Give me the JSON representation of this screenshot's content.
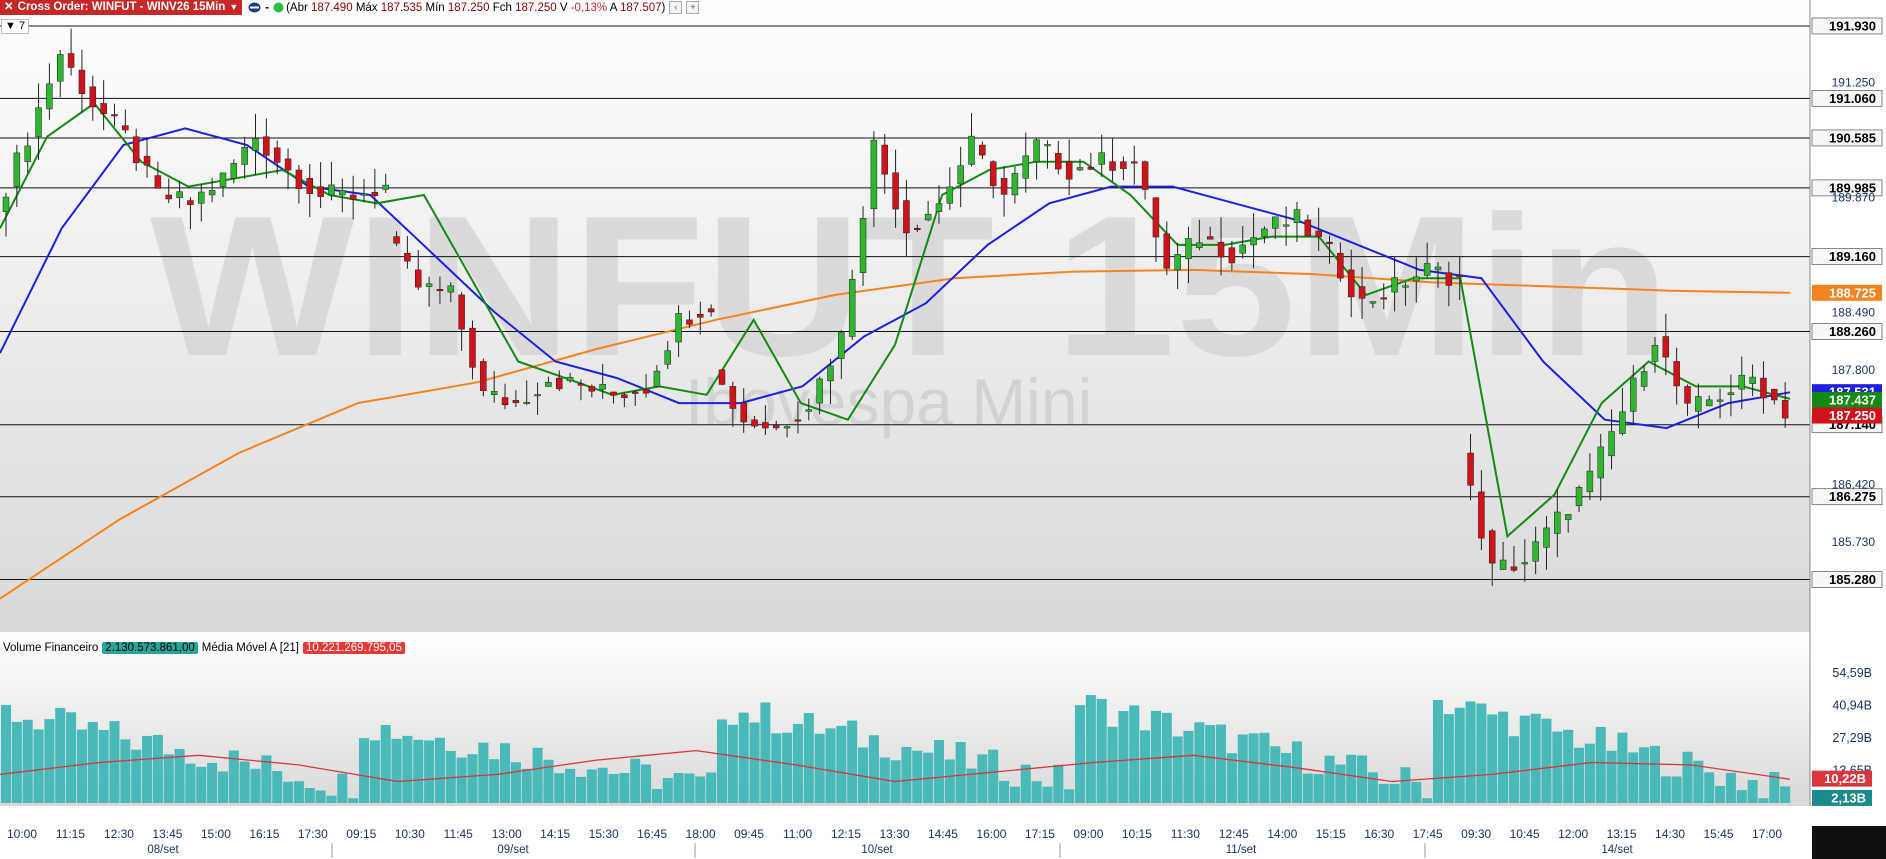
{
  "header": {
    "cross_order_label": "Cross Order: WINFUT - WINV26 15Min",
    "dash": "-",
    "ohlc": {
      "abr_label": "Abr",
      "abr": "187.490",
      "max_label": "Máx",
      "max": "187.535",
      "min_label": "Mín",
      "min": "187.250",
      "fch_label": "Fch",
      "fch": "187.250",
      "v_label": "V",
      "v": "-0,13%",
      "a_label": "A",
      "a": "187.507"
    }
  },
  "candle_count": "7",
  "watermark": {
    "symbol": "WINFUT 15Min",
    "name": "Ibovespa Mini"
  },
  "volume_panel": {
    "label": "Volume Financeiro",
    "value": "2.130.573.861,00",
    "ma_label": "Média Móvel A [21]",
    "ma_value": "10.221.269.795,05"
  },
  "colors": {
    "up": "#2fb52f",
    "down": "#d0131a",
    "ema_fast": "#138a13",
    "ema_mid": "#1f1fe0",
    "ema_slow": "#f5841f",
    "volume": "#4ab9b9",
    "volume_ma": "#d9363e",
    "level_line": "#111111"
  },
  "chart_data": [
    {
      "type": "candlestick",
      "y_axis": {
        "range": [
          184.65,
          192.05
        ],
        "tick_labels": [
          "191.250",
          "189.870",
          "188.490",
          "187.800",
          "186.420",
          "185.730"
        ]
      },
      "x_axis": {
        "time_labels": [
          "10:00",
          "11:15",
          "12:30",
          "13:45",
          "15:00",
          "16:15",
          "17:30",
          "09:15",
          "10:30",
          "11:45",
          "13:00",
          "14:15",
          "15:30",
          "16:45",
          "18:00",
          "09:45",
          "11:00",
          "12:15",
          "13:30",
          "14:45",
          "16:00",
          "17:15",
          "09:00",
          "10:15",
          "11:30",
          "12:45",
          "14:00",
          "15:15",
          "16:30",
          "17:45",
          "09:30",
          "10:45",
          "12:00",
          "13:15",
          "14:30",
          "15:45",
          "17:00"
        ],
        "date_labels": [
          "08/set",
          "09/set",
          "10/set",
          "11/set",
          "14/set"
        ]
      },
      "levels": [
        191.93,
        191.06,
        190.585,
        189.985,
        189.16,
        188.26,
        187.14,
        186.275,
        185.28
      ],
      "level_labels": [
        "191.930",
        "191.060",
        "190.585",
        "189.985",
        "189.160",
        "188.260",
        "187.140",
        "186.275",
        "185.280"
      ],
      "price_tags": [
        {
          "value": 188.725,
          "label": "188.725",
          "color": "#f5841f"
        },
        {
          "value": 187.531,
          "label": "187.531",
          "color": "#1f1fe0"
        },
        {
          "value": 187.437,
          "label": "187.437",
          "color": "#138a13"
        },
        {
          "value": 187.25,
          "label": "187.250",
          "color": "#d0131a"
        }
      ],
      "session_anchors": [
        {
          "o": 189.7,
          "c": 190.6
        },
        {
          "o": 190.6,
          "c": 191.6
        },
        {
          "o": 191.6,
          "c": 191.0
        },
        {
          "o": 191.0,
          "c": 190.6
        },
        {
          "o": 190.6,
          "c": 189.9
        },
        {
          "o": 189.9,
          "c": 189.8
        },
        {
          "o": 189.8,
          "c": 190.1
        },
        {
          "o": 190.1,
          "c": 190.6
        },
        {
          "o": 190.6,
          "c": 190.2
        },
        {
          "o": 190.2,
          "c": 189.9
        },
        {
          "o": 189.9,
          "c": 189.9
        },
        {
          "o": 189.9,
          "c": 190.0
        },
        {
          "o": 189.4,
          "c": 188.8
        },
        {
          "o": 188.8,
          "c": 188.7
        },
        {
          "o": 188.7,
          "c": 187.5
        },
        {
          "o": 187.5,
          "c": 187.4
        },
        {
          "o": 187.4,
          "c": 187.7
        },
        {
          "o": 187.7,
          "c": 187.6
        },
        {
          "o": 187.6,
          "c": 187.5
        },
        {
          "o": 187.5,
          "c": 187.6
        },
        {
          "o": 187.6,
          "c": 188.4
        },
        {
          "o": 188.4,
          "c": 188.6
        },
        {
          "o": 187.8,
          "c": 187.2
        },
        {
          "o": 187.2,
          "c": 187.1
        },
        {
          "o": 187.1,
          "c": 187.4
        },
        {
          "o": 187.4,
          "c": 188.2
        },
        {
          "o": 188.2,
          "c": 190.5
        },
        {
          "o": 190.5,
          "c": 189.5
        },
        {
          "o": 189.5,
          "c": 189.8
        },
        {
          "o": 189.8,
          "c": 190.5
        },
        {
          "o": 190.5,
          "c": 189.9
        },
        {
          "o": 189.9,
          "c": 190.5
        },
        {
          "o": 190.5,
          "c": 190.2
        },
        {
          "o": 190.2,
          "c": 190.3
        },
        {
          "o": 190.3,
          "c": 190.3
        },
        {
          "o": 190.3,
          "c": 189.0
        },
        {
          "o": 189.0,
          "c": 189.4
        },
        {
          "o": 189.4,
          "c": 189.2
        },
        {
          "o": 189.2,
          "c": 189.5
        },
        {
          "o": 189.5,
          "c": 189.6
        },
        {
          "o": 189.6,
          "c": 189.2
        },
        {
          "o": 189.2,
          "c": 188.6
        },
        {
          "o": 188.6,
          "c": 188.8
        },
        {
          "o": 188.8,
          "c": 189.0
        },
        {
          "o": 189.0,
          "c": 188.9
        },
        {
          "o": 186.8,
          "c": 185.4
        },
        {
          "o": 185.4,
          "c": 185.5
        },
        {
          "o": 185.5,
          "c": 186.0
        },
        {
          "o": 186.0,
          "c": 186.5
        },
        {
          "o": 186.5,
          "c": 187.3
        },
        {
          "o": 187.3,
          "c": 188.2
        },
        {
          "o": 188.2,
          "c": 187.3
        },
        {
          "o": 187.3,
          "c": 187.5
        },
        {
          "o": 187.5,
          "c": 187.7
        },
        {
          "o": 187.7,
          "c": 187.3
        }
      ],
      "ema_fast": [
        189.5,
        190.6,
        191.0,
        190.3,
        190.0,
        190.1,
        190.2,
        189.9,
        189.8,
        189.9,
        188.9,
        187.9,
        187.7,
        187.5,
        187.6,
        187.5,
        188.4,
        187.4,
        187.2,
        188.1,
        189.9,
        190.2,
        190.3,
        190.3,
        189.9,
        189.3,
        189.3,
        189.4,
        189.4,
        188.7,
        188.9,
        188.9,
        185.8,
        186.3,
        187.4,
        187.9,
        187.6,
        187.6,
        187.45
      ],
      "ema_mid": [
        188.0,
        189.5,
        190.5,
        190.7,
        190.5,
        190.0,
        189.9,
        189.2,
        188.5,
        187.9,
        187.7,
        187.4,
        187.4,
        187.6,
        188.2,
        188.6,
        189.3,
        189.8,
        190.0,
        190.0,
        189.8,
        189.6,
        189.3,
        189.0,
        188.9,
        187.9,
        187.2,
        187.1,
        187.4,
        187.53
      ],
      "ema_slow": [
        185.05,
        186.0,
        186.8,
        187.4,
        187.65,
        188.05,
        188.4,
        188.7,
        188.9,
        188.98,
        189.0,
        188.95,
        188.85,
        188.8,
        188.75,
        188.725
      ],
      "volume": {
        "range_label_values": [
          "54,59B",
          "40,94B",
          "27,29B",
          "13,65B"
        ],
        "current_label": "2,13B",
        "ma_label": "10,22B",
        "session_levels": [
          {
            "open": 38,
            "close": 6
          },
          {
            "open": 33,
            "close": 6
          },
          {
            "open": 40,
            "close": 8
          },
          {
            "open": 42,
            "close": 6
          },
          {
            "open": 43,
            "close": 4
          }
        ],
        "ma_points": [
          12,
          17,
          20,
          16,
          9,
          12,
          18,
          22,
          16,
          9,
          13,
          17,
          20,
          15,
          9,
          12,
          17,
          16,
          10
        ]
      }
    }
  ]
}
